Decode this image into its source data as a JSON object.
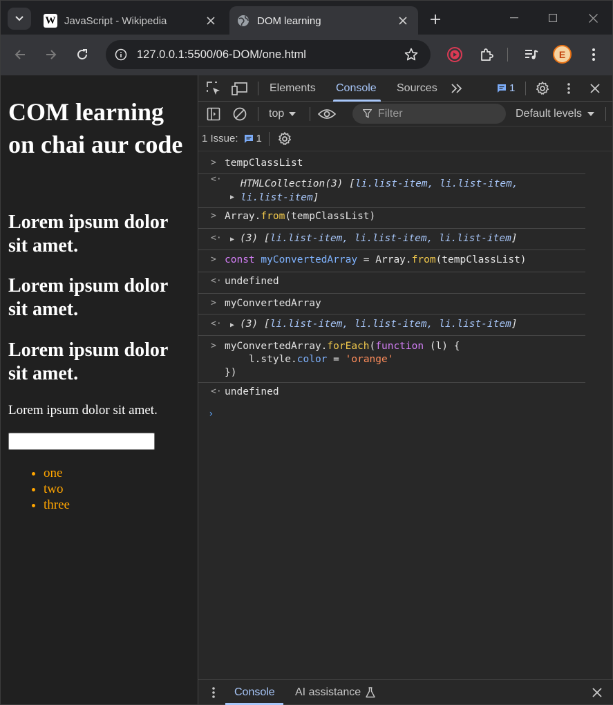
{
  "browser": {
    "tabs": [
      {
        "title": "JavaScript - Wikipedia",
        "icon": "wikipedia-icon",
        "active": false
      },
      {
        "title": "DOM learning",
        "icon": "globe-icon",
        "active": true
      }
    ],
    "wiki_favicon_letter": "W",
    "url": "127.0.0.1:5500/06-DOM/one.html",
    "avatar_letter": "E"
  },
  "page": {
    "heading": "COM learning on chai aur code",
    "subheadings": [
      "Lorem ipsum dolor sit amet.",
      "Lorem ipsum dolor sit amet.",
      "Lorem ipsum dolor sit amet."
    ],
    "paragraph": "Lorem ipsum dolor sit amet.",
    "list_items": [
      "one",
      "two",
      "three"
    ],
    "list_color": "#ffa500"
  },
  "devtools": {
    "tabs": [
      "Elements",
      "Console",
      "Sources"
    ],
    "active_tab": "Console",
    "issue_count": "1",
    "context": "top",
    "filter_placeholder": "Filter",
    "levels": "Default levels",
    "issues_label": "1 Issue:",
    "console": {
      "line1_input": "tempClassList",
      "line1_output_prefix": "HTMLCollection(3) [",
      "line1_output_items_a": "li.list-item, li.list-item,",
      "line1_output_items_b": "li.list-item",
      "close_bracket": "]",
      "line2_input_a": "Array.",
      "line2_input_fn": "from",
      "line2_input_b": "(tempClassList)",
      "array_prefix": "(3) [",
      "array_items": "li.list-item, li.list-item, li.list-item",
      "line3_kw": "const",
      "line3_var": "myConvertedArray",
      "line3_rest_a": " = Array.",
      "line3_fn": "from",
      "line3_rest_b": "(tempClassList)",
      "undefined": "undefined",
      "line4_input": "myConvertedArray",
      "line5_a": "myConvertedArray.",
      "line5_fn": "forEach",
      "line5_paren": "(",
      "line5_kw": "function",
      "line5_param": " (l) {",
      "line5_body_a": "    l.style.",
      "line5_body_var": "color",
      "line5_body_eq": " = ",
      "line5_body_str": "'orange'",
      "line5_close": "})"
    },
    "drawer_tabs": [
      "Console",
      "AI assistance"
    ]
  }
}
